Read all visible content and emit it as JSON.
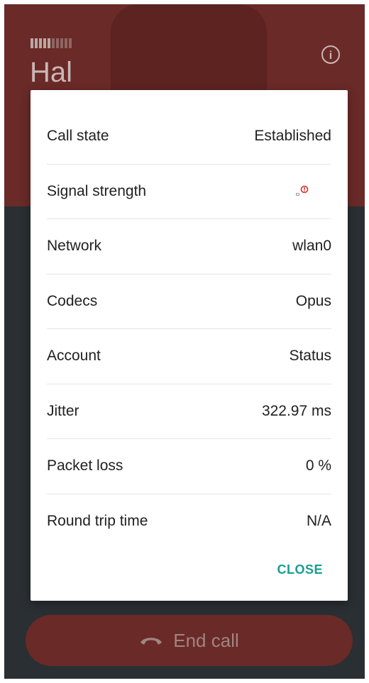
{
  "background": {
    "title": "Hal",
    "end_call_label": "End call"
  },
  "dialog": {
    "rows": [
      {
        "label": "Call state",
        "value": "Established"
      },
      {
        "label": "Signal strength",
        "value": ""
      },
      {
        "label": "Network",
        "value": "wlan0"
      },
      {
        "label": "Codecs",
        "value": "Opus"
      },
      {
        "label": "Account",
        "value": "Status"
      },
      {
        "label": "Jitter",
        "value": "322.97 ms"
      },
      {
        "label": "Packet loss",
        "value": "0 %"
      },
      {
        "label": "Round trip time",
        "value": "N/A"
      }
    ],
    "close_label": "CLOSE"
  },
  "colors": {
    "accent": "#1a9e8f",
    "header": "#6a2a27",
    "signal_warning": "#d93025"
  },
  "icons": {
    "info": "info-icon",
    "signal": "signal-warning-icon",
    "phone": "phone-hangup-icon"
  }
}
